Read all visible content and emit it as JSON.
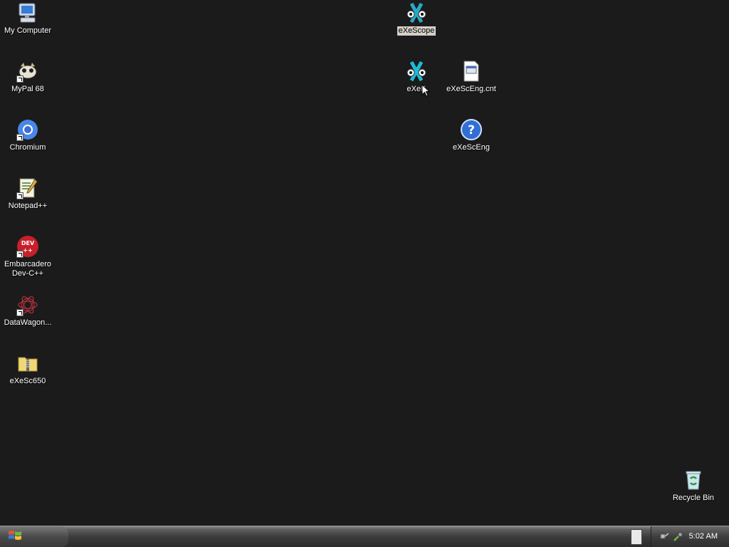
{
  "desktop": {
    "icons": {
      "my_computer": "My Computer",
      "mypal": "MyPal 68",
      "chromium": "Chromium",
      "notepadpp": "Notepad++",
      "devcpp": "Embarcadero Dev-C++",
      "datawagon": "DataWagon...",
      "exesc650": "eXeSc650",
      "exescope": "eXeScope",
      "exebin": "eXeB",
      "exesceng_cnt": "eXeScEng.cnt",
      "exesceng": "eXeScEng",
      "recycle_bin": "Recycle Bin"
    }
  },
  "taskbar": {
    "clock": "5:02 AM"
  },
  "colors": {
    "desktop_background": "#1b1b1b",
    "label_text": "#ffffff",
    "selection": "#d4d0c8"
  }
}
